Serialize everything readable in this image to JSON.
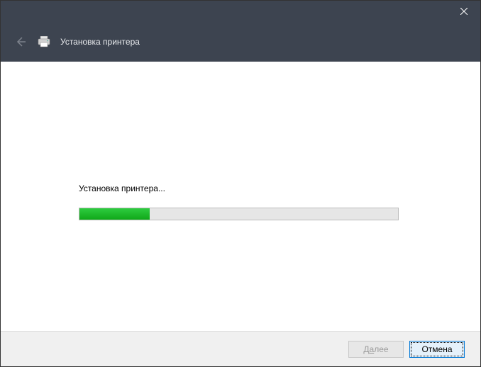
{
  "header": {
    "title": "Установка принтера"
  },
  "content": {
    "status_text": "Установка принтера...",
    "progress_percent": 22
  },
  "footer": {
    "next_label_before": "Д",
    "next_label_underline": "а",
    "next_label_after": "лее",
    "cancel_label": "Отмена"
  }
}
